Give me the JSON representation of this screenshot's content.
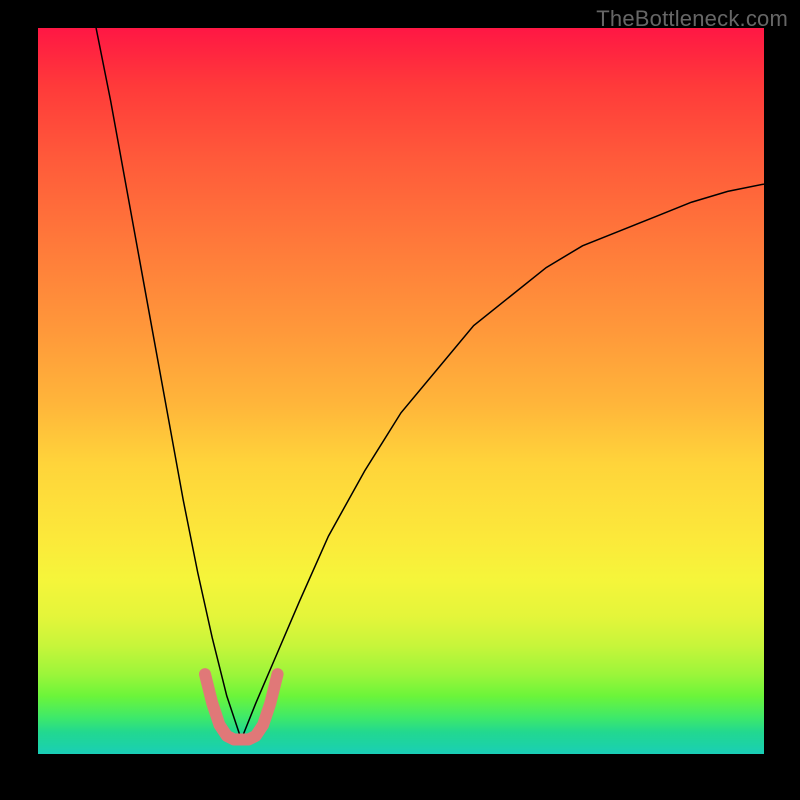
{
  "watermark": "TheBottleneck.com",
  "chart_data": {
    "type": "line",
    "title": "",
    "xlabel": "",
    "ylabel": "",
    "xlim": [
      0,
      100
    ],
    "ylim": [
      0,
      100
    ],
    "grid": false,
    "legend": false,
    "annotations": [],
    "description": "Two black curves forming a V shape dipping to near-zero around x≈28; a short salmon U-shaped marker segment sits at the bottom of the dip.",
    "series": [
      {
        "name": "left-curve",
        "stroke": "#000000",
        "x": [
          8,
          10,
          12,
          14,
          16,
          18,
          20,
          22,
          24,
          26,
          28
        ],
        "y": [
          100,
          90,
          79,
          68,
          57,
          46,
          35,
          25,
          16,
          8,
          2
        ]
      },
      {
        "name": "right-curve",
        "stroke": "#000000",
        "x": [
          28,
          30,
          33,
          36,
          40,
          45,
          50,
          55,
          60,
          65,
          70,
          75,
          80,
          85,
          90,
          95,
          100
        ],
        "y": [
          2,
          7,
          14,
          21,
          30,
          39,
          47,
          53,
          59,
          63,
          67,
          70,
          72,
          74,
          76,
          77.5,
          78.5
        ]
      },
      {
        "name": "bottom-marker",
        "stroke": "#e07878",
        "x": [
          23,
          24,
          25,
          26,
          27,
          28,
          29,
          30,
          31,
          32,
          33
        ],
        "y": [
          11,
          7,
          4,
          2.5,
          2,
          2,
          2,
          2.5,
          4,
          7,
          11
        ]
      }
    ]
  }
}
